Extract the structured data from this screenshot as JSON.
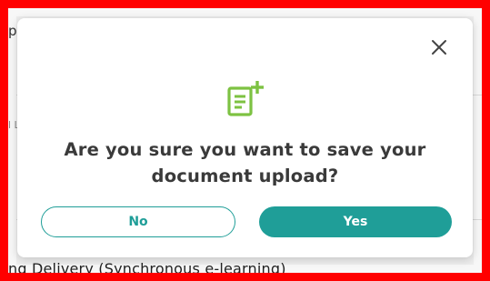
{
  "background": {
    "top_text": "pe",
    "mid_text": "l L",
    "bottom_text": "ng Delivery (Synchronous e-learning)"
  },
  "dialog": {
    "question": "Are you sure you want to save your document upload?",
    "no_label": "No",
    "yes_label": "Yes",
    "close_icon": "close-icon",
    "header_icon": "document-add-icon"
  },
  "colors": {
    "frame": "#ff0000",
    "accent": "#1f9e98",
    "icon_green": "#7dc242"
  }
}
